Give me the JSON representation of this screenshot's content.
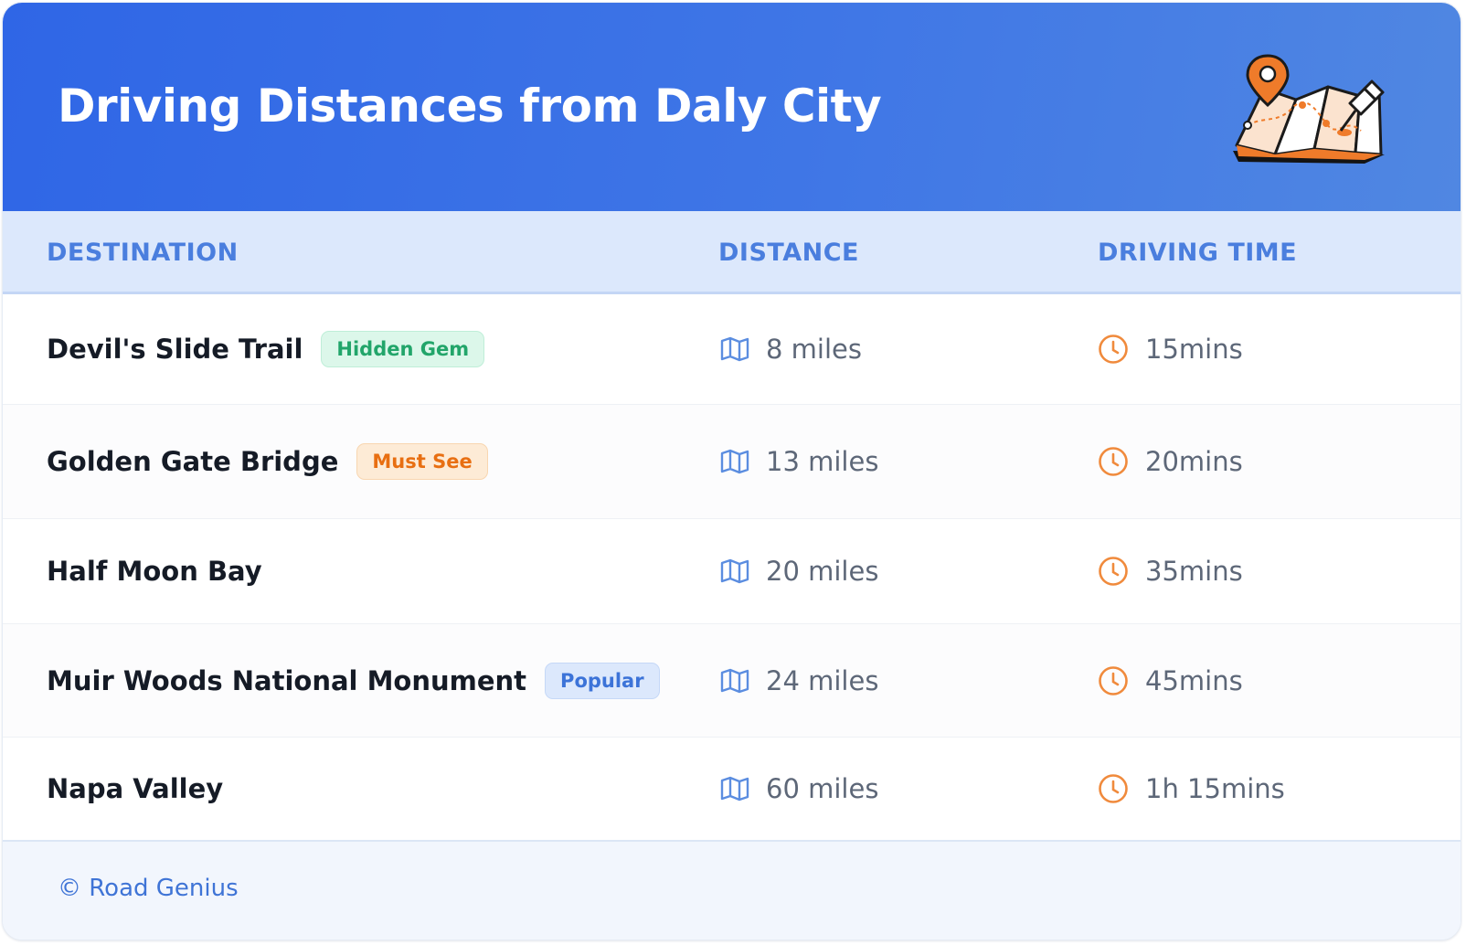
{
  "header": {
    "title": "Driving Distances from Daly City",
    "illustration": "folded-map-with-location-pin-icon"
  },
  "table": {
    "columns": [
      "DESTINATION",
      "DISTANCE",
      "DRIVING TIME"
    ],
    "rows": [
      {
        "destination": "Devil's Slide Trail",
        "badge": "Hidden Gem",
        "badge_color": "#22a56a",
        "distance": "8 miles",
        "time": "15mins"
      },
      {
        "destination": "Golden Gate Bridge",
        "badge": "Must See",
        "badge_color": "#e86f12",
        "distance": "13 miles",
        "time": "20mins"
      },
      {
        "destination": "Half Moon Bay",
        "badge": "",
        "badge_color": "",
        "distance": "20 miles",
        "time": "35mins"
      },
      {
        "destination": "Muir Woods National Monument",
        "badge": "Popular",
        "badge_color": "#3c73d8",
        "distance": "24 miles",
        "time": "45mins"
      },
      {
        "destination": "Napa Valley",
        "badge": "",
        "badge_color": "",
        "distance": "60 miles",
        "time": "1h 15mins"
      }
    ],
    "distance_icon": "map-icon",
    "time_icon": "clock-icon"
  },
  "footer": {
    "text": "© Road Genius"
  },
  "colors": {
    "header_gradient_start": "#2f66e6",
    "header_gradient_end": "#5087e2",
    "table_head_bg": "#dce8fc",
    "column_header_text": "#4a7ede",
    "map_icon": "#5b8de0",
    "clock_icon": "#f08a3c",
    "footer_text": "#3f74d6"
  }
}
